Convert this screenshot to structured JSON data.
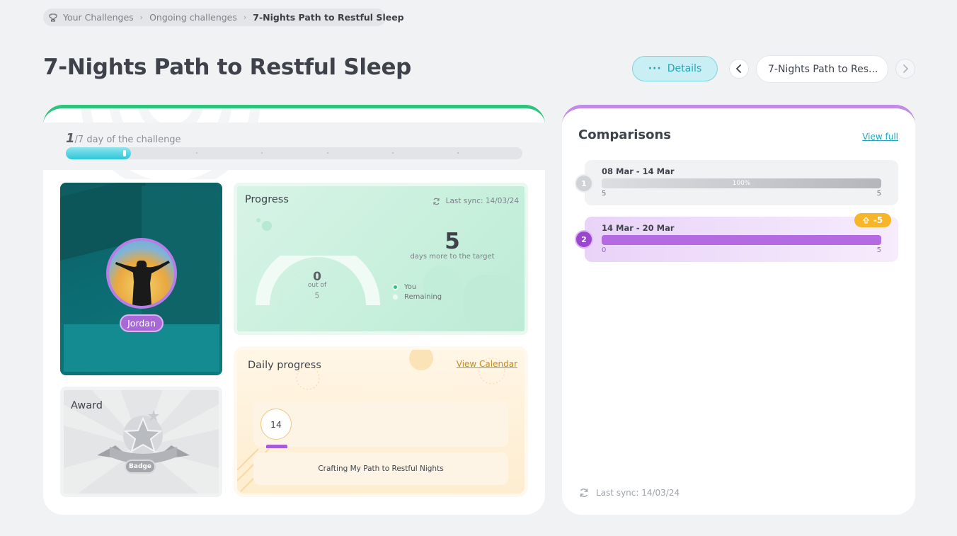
{
  "breadcrumb": {
    "items": [
      "Your Challenges",
      "Ongoing challenges",
      "7-Nights Path to Restful Sleep"
    ]
  },
  "page_title": "7-Nights Path to Restful Sleep",
  "header": {
    "details_label": "Details",
    "nav_title": "7-Nights Path to Res..."
  },
  "challenge_day": {
    "current": "1",
    "suffix": "/7 day of the challenge",
    "progress_fraction": 0.1429
  },
  "participant": {
    "name": "Jordan"
  },
  "award": {
    "title": "Award",
    "badge_label": "Badge"
  },
  "progress": {
    "title": "Progress",
    "last_sync": "Last sync: 14/03/24",
    "remaining_days": "5",
    "remaining_caption": "days more to the target",
    "gauge_value": "0",
    "gauge_of": "out of",
    "gauge_total": "5",
    "legend_you": "You",
    "legend_remaining": "Remaining"
  },
  "daily_progress": {
    "title": "Daily progress",
    "view_calendar": "View Calendar",
    "day": "14",
    "task": "Crafting My Path to Restful Nights"
  },
  "comparisons": {
    "title": "Comparisons",
    "view_full": "View full",
    "rows": [
      {
        "rank": "1",
        "range": "08 Mar - 14 Mar",
        "percent": "100%",
        "min": "5",
        "max": "5"
      },
      {
        "rank": "2",
        "range": "14 Mar - 20 Mar",
        "min": "0",
        "max": "5"
      }
    ],
    "delta": "-5",
    "last_sync": "Last sync: 14/03/24"
  },
  "colors": {
    "accent_teal": "#21a7ba",
    "accent_green": "#2dc47e",
    "accent_purple": "#9b46cf",
    "accent_orange": "#f7b52a"
  }
}
